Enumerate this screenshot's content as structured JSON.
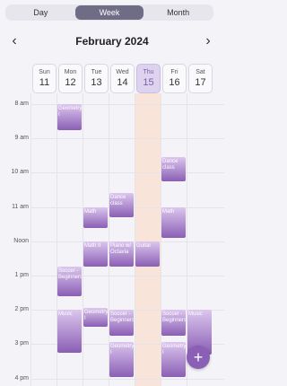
{
  "view_switch": {
    "day": "Day",
    "week": "Week",
    "month": "Month",
    "selected": "Week"
  },
  "header": {
    "month_title": "February 2024"
  },
  "days": [
    {
      "name": "Sun",
      "date": "11"
    },
    {
      "name": "Mon",
      "date": "12"
    },
    {
      "name": "Tue",
      "date": "13"
    },
    {
      "name": "Wed",
      "date": "14"
    },
    {
      "name": "Thu",
      "date": "15"
    },
    {
      "name": "Fri",
      "date": "16"
    },
    {
      "name": "Sat",
      "date": "17"
    }
  ],
  "today_index": 4,
  "times": [
    "8 am",
    "9 am",
    "10 am",
    "11 am",
    "Noon",
    "1 pm",
    "2 pm",
    "3 pm",
    "4 pm"
  ],
  "events": [
    {
      "title": "Geometry I",
      "day": 1,
      "start": 8.0,
      "end": 8.75
    },
    {
      "title": "Soccer - Beginners",
      "day": 1,
      "start": 12.75,
      "end": 13.6
    },
    {
      "title": "Music",
      "day": 1,
      "start": 14.0,
      "end": 15.25
    },
    {
      "title": "Math",
      "day": 2,
      "start": 11.0,
      "end": 11.6
    },
    {
      "title": "Math II",
      "day": 2,
      "start": 12.0,
      "end": 12.75
    },
    {
      "title": "Geometry I",
      "day": 2,
      "start": 13.95,
      "end": 14.5
    },
    {
      "title": "Dance class",
      "day": 3,
      "start": 10.6,
      "end": 11.3
    },
    {
      "title": "Piano w/ Octavia",
      "day": 3,
      "start": 12.0,
      "end": 12.75
    },
    {
      "title": "Soccer - Beginners",
      "day": 3,
      "start": 14.0,
      "end": 14.75
    },
    {
      "title": "Geometry I",
      "day": 3,
      "start": 14.95,
      "end": 15.95
    },
    {
      "title": "Guitar",
      "day": 4,
      "start": 12.0,
      "end": 12.75
    },
    {
      "title": "Dance class",
      "day": 5,
      "start": 9.55,
      "end": 10.25
    },
    {
      "title": "Math",
      "day": 5,
      "start": 11.0,
      "end": 11.9
    },
    {
      "title": "Soccer - Beginners",
      "day": 5,
      "start": 14.0,
      "end": 14.75
    },
    {
      "title": "Geometry I",
      "day": 5,
      "start": 14.95,
      "end": 15.95
    },
    {
      "title": "Music",
      "day": 6,
      "start": 14.0,
      "end": 15.3
    }
  ],
  "icons": {
    "prev": "chevron-left-icon",
    "next": "chevron-right-icon",
    "add": "plus-icon"
  }
}
